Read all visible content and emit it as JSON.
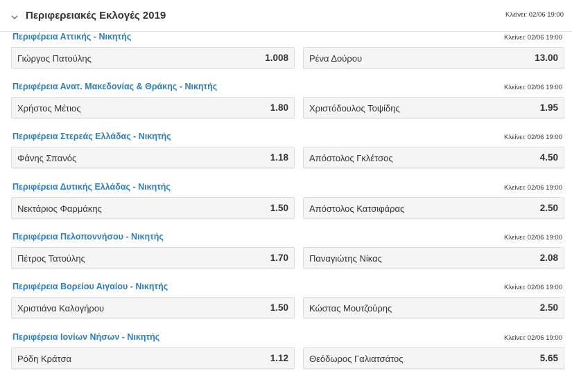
{
  "header": {
    "title": "Περιφερειακές Εκλογές 2019",
    "close_time": "Κλείνει: 02/06 19:00"
  },
  "markets": [
    {
      "title": "Περιφέρεια Αττικής - Νικητής",
      "close_time": "Κλείνει: 02/06 19:00",
      "outcomes": [
        {
          "name": "Γιώργος Πατούλης",
          "odds": "1.008"
        },
        {
          "name": "Ρένα Δούρου",
          "odds": "13.00"
        }
      ]
    },
    {
      "title": "Περιφέρεια Ανατ. Μακεδονίας & Θράκης - Νικητής",
      "close_time": "Κλείνει: 02/06 19:00",
      "outcomes": [
        {
          "name": "Χρήστος Μέτιος",
          "odds": "1.80"
        },
        {
          "name": "Χριστόδουλος Τοψίδης",
          "odds": "1.95"
        }
      ]
    },
    {
      "title": "Περιφέρεια Στερεάς Ελλάδας - Νικητής",
      "close_time": "Κλείνει: 02/06 19:00",
      "outcomes": [
        {
          "name": "Φάνης Σπανός",
          "odds": "1.18"
        },
        {
          "name": "Απόστολος Γκλέτσος",
          "odds": "4.50"
        }
      ]
    },
    {
      "title": "Περιφέρεια Δυτικής Ελλάδας - Νικητής",
      "close_time": "Κλείνει: 02/06 19:00",
      "outcomes": [
        {
          "name": "Νεκτάριος Φαρμάκης",
          "odds": "1.50"
        },
        {
          "name": "Απόστολος Κατσιφάρας",
          "odds": "2.50"
        }
      ]
    },
    {
      "title": "Περιφέρεια Πελοποννήσου - Νικητής",
      "close_time": "Κλείνει: 02/06 19:00",
      "outcomes": [
        {
          "name": "Πέτρος Τατούλης",
          "odds": "1.70"
        },
        {
          "name": "Παναγιώτης Νίκας",
          "odds": "2.08"
        }
      ]
    },
    {
      "title": "Περιφέρεια Βορείου Αιγαίου - Νικητής",
      "close_time": "Κλείνει: 02/06 19:00",
      "outcomes": [
        {
          "name": "Χριστιάνα Καλογήρου",
          "odds": "1.50"
        },
        {
          "name": "Κώστας Μουτζούρης",
          "odds": "2.50"
        }
      ]
    },
    {
      "title": "Περιφέρεια Ιονίων Νήσων - Νικητής",
      "close_time": "Κλείνει: 02/06 19:00",
      "outcomes": [
        {
          "name": "Ρόδη Κράτσα",
          "odds": "1.12"
        },
        {
          "name": "Θεόδωρος Γαλιατσάτος",
          "odds": "5.65"
        }
      ]
    }
  ],
  "colors": {
    "market_title": "#2d7fc1",
    "text": "#333333",
    "outcome_bg": "#f5f5f5",
    "outcome_border": "#dedede"
  },
  "icons": {
    "collapse": "chevron-down-icon"
  }
}
